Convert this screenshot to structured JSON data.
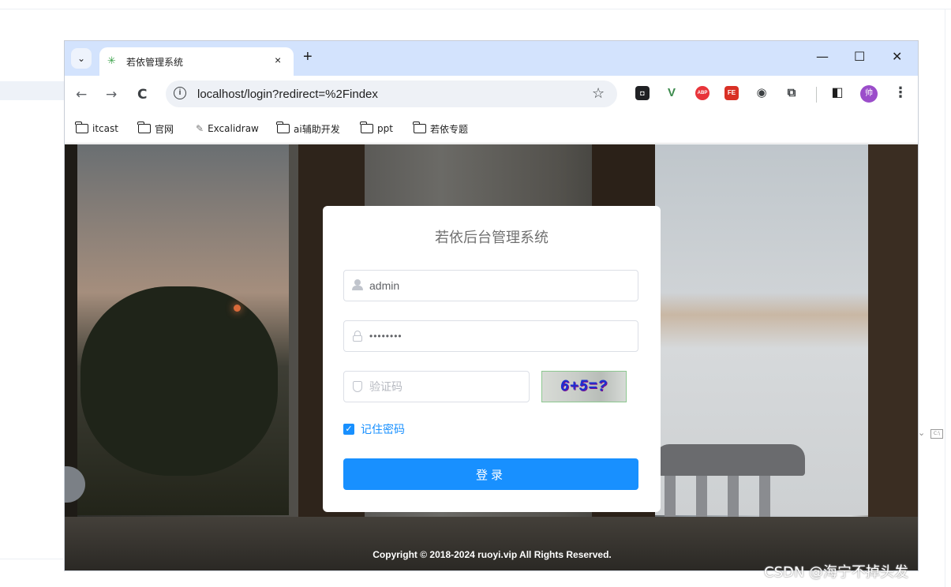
{
  "browser": {
    "tab": {
      "title": "若依管理系统",
      "favicon": "ruoyi-leaf-icon",
      "close": "×"
    },
    "tab_search_glyph": "⌄",
    "new_tab": "+",
    "window_controls": {
      "minimize": "—",
      "maximize": "☐",
      "close": "✕"
    },
    "nav": {
      "back": "←",
      "forward": "→",
      "reload": "C"
    },
    "address": {
      "url": "localhost/login?redirect=%2Findex",
      "info_glyph": "i",
      "star": "☆"
    },
    "extensions": [
      {
        "name": "tampermonkey-icon",
        "glyph": "◘",
        "color": "#202124"
      },
      {
        "name": "vue-devtools-icon",
        "glyph": "V",
        "color": "#3b8a4c"
      },
      {
        "name": "adblock-plus-icon",
        "glyph": "ABP",
        "color": "#e8343a"
      },
      {
        "name": "fe-helper-icon",
        "glyph": "FE",
        "color": "#d93025"
      },
      {
        "name": "copilot-extension-icon",
        "glyph": "◉",
        "color": "#3c4043"
      },
      {
        "name": "extensions-puzzle-icon",
        "glyph": "⧉",
        "color": "#3c4043"
      }
    ],
    "side_panel_glyph": "◧",
    "avatar_text": "帅",
    "menu_glyph": "⋮",
    "bookmarks": [
      {
        "label": "itcast",
        "type": "folder"
      },
      {
        "label": "官网",
        "type": "folder"
      },
      {
        "label": "Excalidraw",
        "type": "page"
      },
      {
        "label": "ai辅助开发",
        "type": "folder"
      },
      {
        "label": "ppt",
        "type": "folder"
      },
      {
        "label": "若依专题",
        "type": "folder"
      }
    ]
  },
  "login": {
    "title": "若依后台管理系统",
    "username_value": "admin",
    "password_value": "••••••••",
    "captcha_placeholder": "验证码",
    "captcha_text": "6+5=?",
    "remember_label": "记住密码",
    "remember_check": "✓",
    "submit_label": "登录"
  },
  "footer": "Copyright © 2018-2024 ruoyi.vip All Rights Reserved.",
  "watermark": "CSDN @海宁不掉头发",
  "colors": {
    "primary": "#1890ff",
    "tabbar": "#d3e3fd"
  }
}
